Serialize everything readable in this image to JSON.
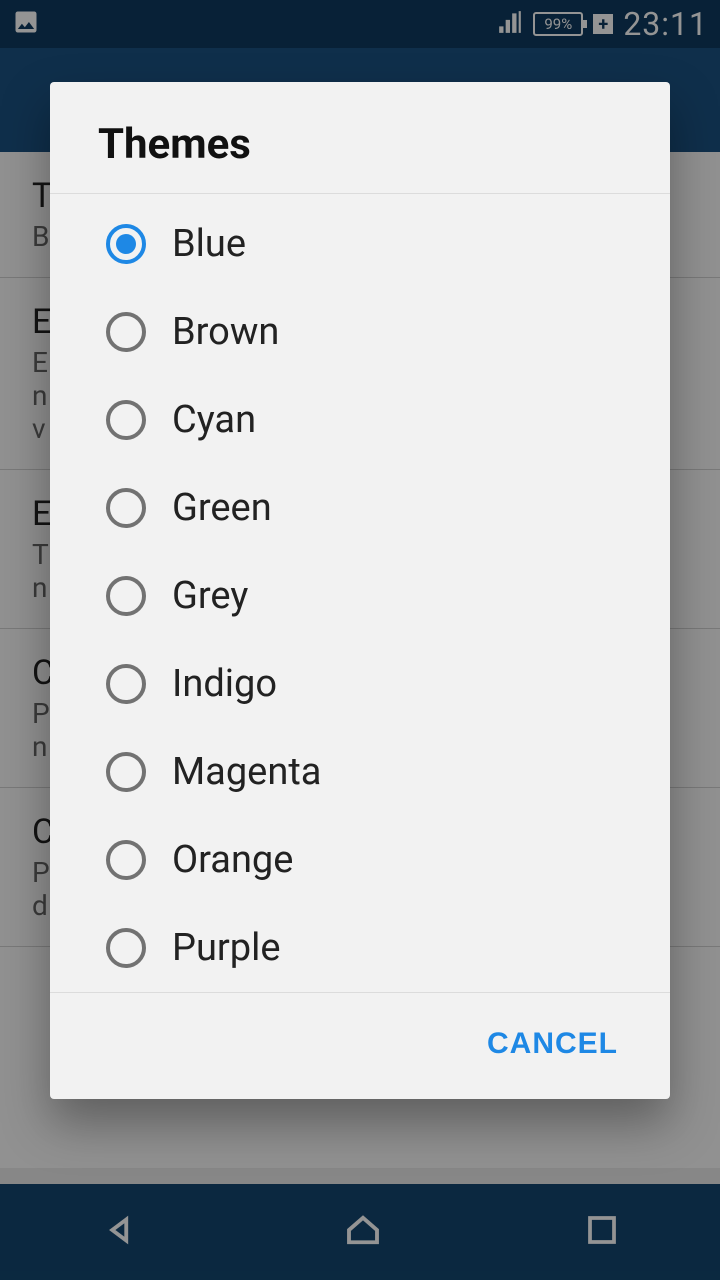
{
  "status": {
    "battery_pct": "99%",
    "time": "23:11"
  },
  "background_settings": [
    {
      "title": "T",
      "sub": "B"
    },
    {
      "title": "E",
      "sub": "E\nn\nv"
    },
    {
      "title": "E",
      "sub": "T\nn"
    },
    {
      "title": "C",
      "sub": "P\nn"
    },
    {
      "title": "C",
      "sub": "P\nd"
    }
  ],
  "dialog": {
    "title": "Themes",
    "options": [
      {
        "label": "Blue",
        "selected": true
      },
      {
        "label": "Brown",
        "selected": false
      },
      {
        "label": "Cyan",
        "selected": false
      },
      {
        "label": "Green",
        "selected": false
      },
      {
        "label": "Grey",
        "selected": false
      },
      {
        "label": "Indigo",
        "selected": false
      },
      {
        "label": "Magenta",
        "selected": false
      },
      {
        "label": "Orange",
        "selected": false
      },
      {
        "label": "Purple",
        "selected": false
      }
    ],
    "cancel_label": "CANCEL"
  }
}
